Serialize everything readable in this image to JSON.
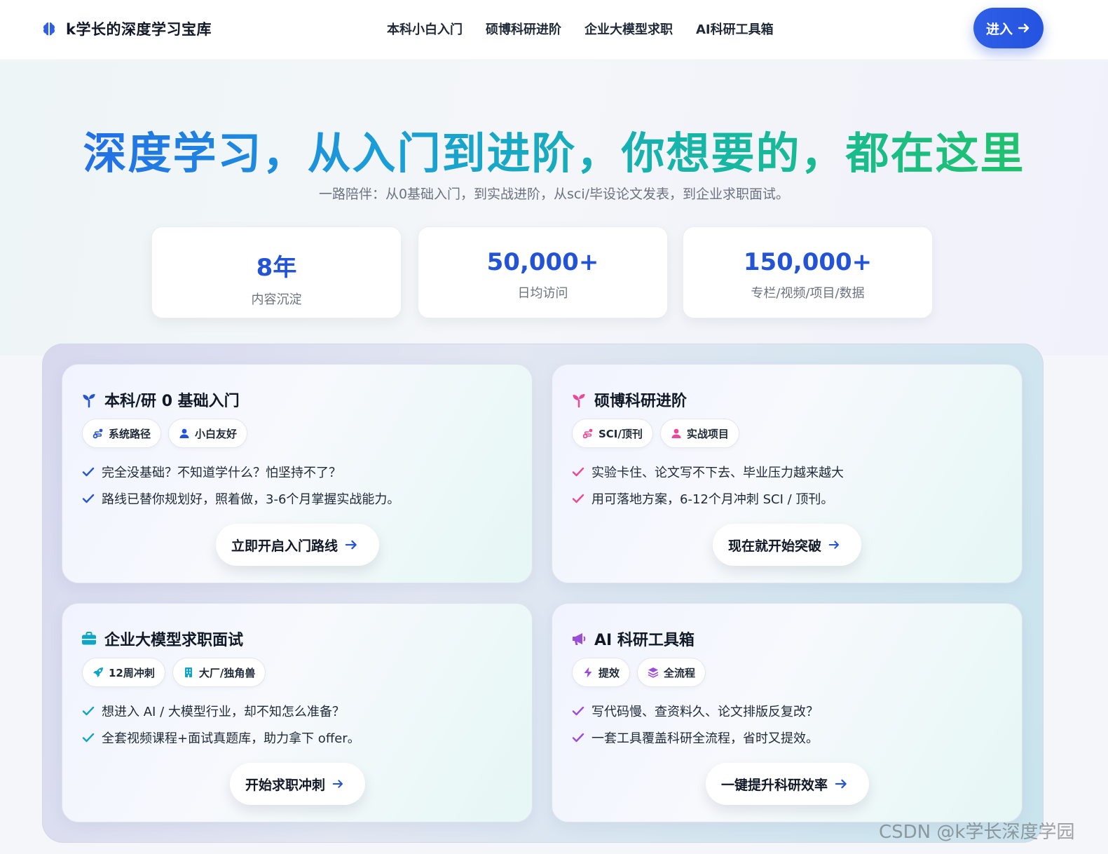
{
  "header": {
    "brand": "k学长的深度学习宝库",
    "nav": [
      "本科小白入门",
      "硕博科研进阶",
      "企业大模型求职",
      "AI科研工具箱"
    ],
    "enter_label": "进入"
  },
  "hero": {
    "title": "深度学习，从入门到进阶，你想要的，都在这里",
    "subtitle": "一路陪伴：从0基础入门，到实战进阶，从sci/毕设论文发表，到企业求职面试。",
    "stats": [
      {
        "value": "8年",
        "label": "内容沉淀"
      },
      {
        "value": "50,000+",
        "label": "日均访问"
      },
      {
        "value": "150,000+",
        "label": "专栏/视频/项目/数据"
      }
    ]
  },
  "cards": [
    {
      "title": "本科/研 0 基础入门",
      "icon": "sprout-icon",
      "accent": "#2454d6",
      "tags": [
        {
          "icon": "route-icon",
          "label": "系统路径"
        },
        {
          "icon": "user-icon",
          "label": "小白友好"
        }
      ],
      "bullets": [
        "完全没基础？不知道学什么？怕坚持不了？",
        "路线已替你规划好，照着做，3-6个月掌握实战能力。"
      ],
      "cta": "立即开启入门路线"
    },
    {
      "title": "硕博科研进阶",
      "icon": "sprout-icon",
      "accent": "#ec4899",
      "tags": [
        {
          "icon": "route-icon",
          "label": "SCI/顶刊"
        },
        {
          "icon": "user-icon",
          "label": "实战项目"
        }
      ],
      "bullets": [
        "实验卡住、论文写不下去、毕业压力越来越大",
        "用可落地方案，6-12个月冲刺 SCI / 顶刊。"
      ],
      "cta": "现在就开始突破"
    },
    {
      "title": "企业大模型求职面试",
      "icon": "briefcase-icon",
      "accent": "#0ea5c6",
      "tags": [
        {
          "icon": "rocket-icon",
          "label": "12周冲刺"
        },
        {
          "icon": "building-icon",
          "label": "大厂/独角兽"
        }
      ],
      "bullets": [
        "想进入 AI / 大模型行业，却不知怎么准备？",
        "全套视频课程+面试真题库，助力拿下 offer。"
      ],
      "cta": "开始求职冲刺"
    },
    {
      "title": "AI 科研工具箱",
      "icon": "megaphone-icon",
      "accent": "#9b4dd9",
      "tags": [
        {
          "icon": "bolt-icon",
          "label": "提效"
        },
        {
          "icon": "layers-icon",
          "label": "全流程"
        }
      ],
      "bullets": [
        "写代码慢、查资料久、论文排版反复改？",
        "一套工具覆盖科研全流程，省时又提效。"
      ],
      "cta": "一键提升科研效率"
    }
  ],
  "watermark": "CSDN @k学长深度学园"
}
